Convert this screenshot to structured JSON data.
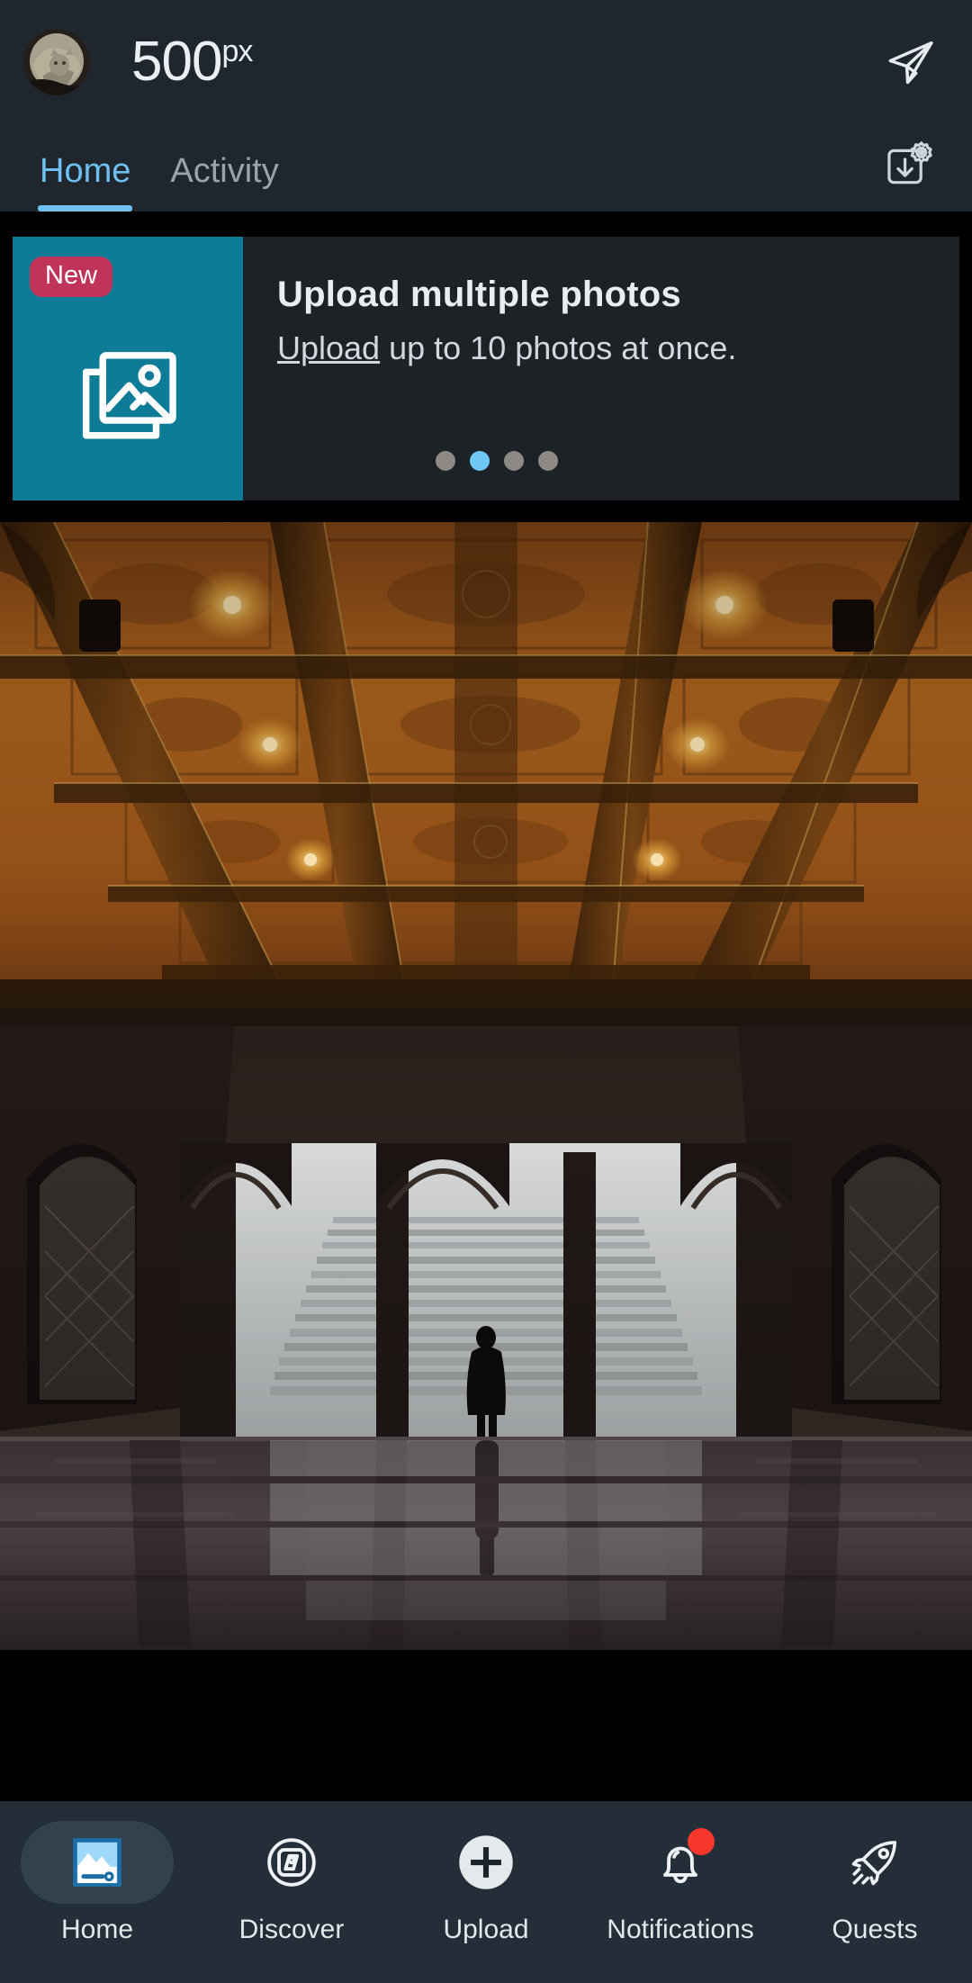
{
  "header": {
    "avatar_name": "user-avatar",
    "logo_main": "500",
    "logo_suffix": "px",
    "send_icon": "paper-plane-icon"
  },
  "tabs": {
    "items": [
      {
        "label": "Home",
        "active": true
      },
      {
        "label": "Activity",
        "active": false
      }
    ],
    "download_settings_icon": "download-settings-gear-icon",
    "active_color": "#6fc0f0",
    "inactive_color": "#9aa3aa"
  },
  "banner": {
    "badge": "New",
    "badge_color": "#c1345a",
    "panel_color": "#0e7c96",
    "icon": "stacked-photos-icon",
    "title": "Upload multiple photos",
    "subtitle_link": "Upload",
    "subtitle_rest": " up to 10 photos at once.",
    "pagination": {
      "total": 4,
      "active_index": 1,
      "active_color": "#6fc8f5",
      "inactive_color": "#8d8a85"
    }
  },
  "photo": {
    "alt": "Ornate tiled arcade ceiling with arches and a lone silhouetted figure on stairs"
  },
  "bottom_nav": {
    "items": [
      {
        "label": "Home",
        "icon": "landscape-photo-icon",
        "active": true,
        "badge": false
      },
      {
        "label": "Discover",
        "icon": "compass-discover-icon",
        "active": false,
        "badge": false
      },
      {
        "label": "Upload",
        "icon": "plus-circle-icon",
        "active": false,
        "badge": false
      },
      {
        "label": "Notifications",
        "icon": "bell-icon",
        "active": false,
        "badge": true
      },
      {
        "label": "Quests",
        "icon": "rocket-icon",
        "active": false,
        "badge": false
      }
    ],
    "badge_color": "#f8372c",
    "active_pill_color": "#31414e",
    "bar_color": "#242e38"
  }
}
